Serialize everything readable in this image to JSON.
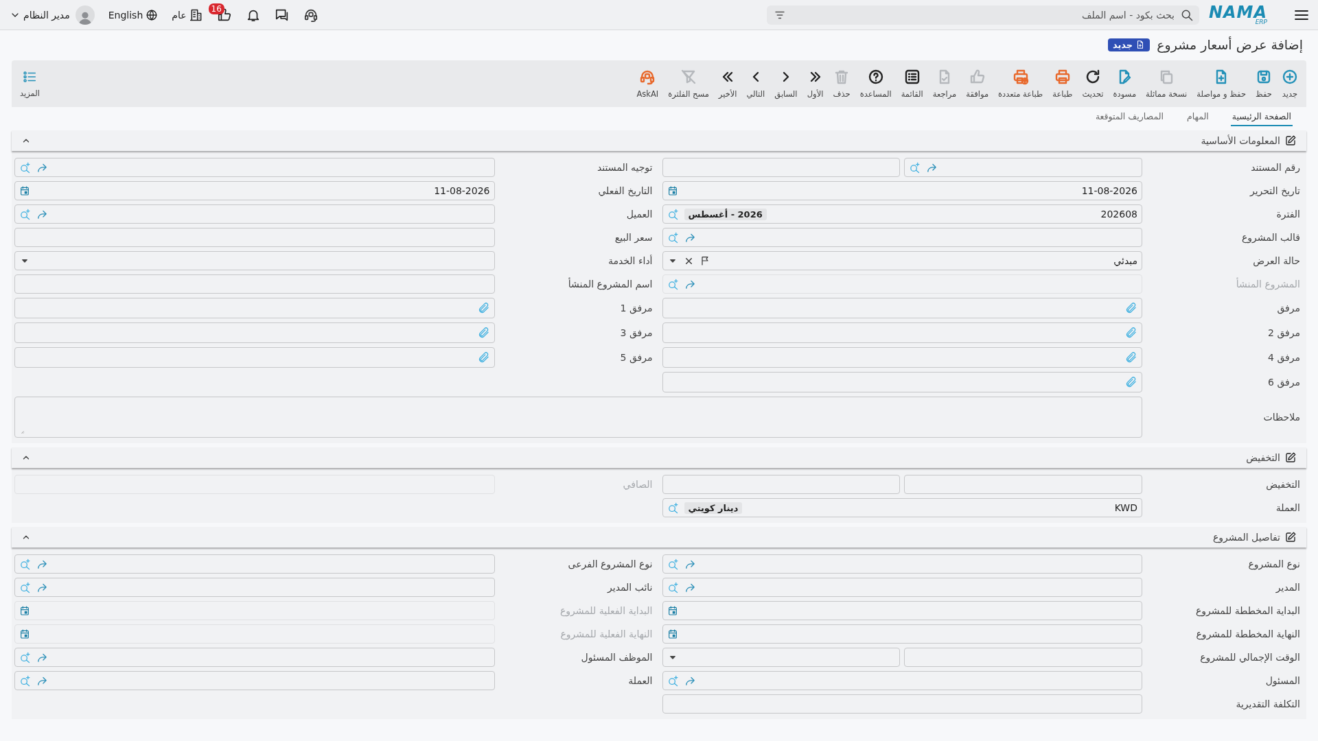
{
  "topbar": {
    "logo": {
      "name": "NAMA",
      "sub": "ERP"
    },
    "search": {
      "placeholder": "بحث بكود - اسم الملف"
    },
    "notifications_badge": "16",
    "company": "عام",
    "language": "English",
    "user": "مدير النظام"
  },
  "page_title": "إضافة عرض أسعار مشروع",
  "status_badge": "جديد",
  "toolbar": [
    {
      "label": "جديد",
      "kind": "add",
      "color": "#2391b8"
    },
    {
      "label": "حفظ",
      "kind": "save",
      "color": "#2391b8"
    },
    {
      "label": "حفظ و مواصلة",
      "kind": "savenext",
      "color": "#2391b8"
    },
    {
      "label": "نسخة مماثلة",
      "kind": "copy",
      "color": "#b5b8bc"
    },
    {
      "label": "مسودة",
      "kind": "draft",
      "color": "#2391b8"
    },
    {
      "label": "تحديث",
      "kind": "refresh",
      "color": "#222222"
    },
    {
      "label": "طباعة",
      "kind": "print",
      "color": "#e8692c"
    },
    {
      "label": "طباعة متعددة",
      "kind": "printmany",
      "color": "#e8692c"
    },
    {
      "label": "موافقة",
      "kind": "approve",
      "color": "#b5b8bc"
    },
    {
      "label": "مراجعة",
      "kind": "review",
      "color": "#b5b8bc"
    },
    {
      "label": "القائمة",
      "kind": "list",
      "color": "#222222"
    },
    {
      "label": "المساعدة",
      "kind": "help",
      "color": "#222222"
    },
    {
      "label": "حذف",
      "kind": "delete",
      "color": "#b5b8bc"
    },
    {
      "label": "الأول",
      "kind": "first",
      "color": "#222222"
    },
    {
      "label": "السابق",
      "kind": "previous",
      "color": "#222222"
    },
    {
      "label": "التالي",
      "kind": "next",
      "color": "#222222"
    },
    {
      "label": "الأخير",
      "kind": "last",
      "color": "#222222"
    },
    {
      "label": "مسح الفلترة",
      "kind": "unfilter",
      "color": "#b5b8bc"
    },
    {
      "label": "AskAI",
      "kind": "askai",
      "color": "#e8692c"
    }
  ],
  "more": {
    "label": "المزيد"
  },
  "tabs": [
    {
      "label": "الصفحة الرئيسية",
      "selected": true
    },
    {
      "label": "المهام",
      "selected": false
    },
    {
      "label": "المصاريف المتوقعة",
      "selected": false
    }
  ],
  "sections": [
    {
      "title": "المعلومات الأساسية",
      "expanded": true,
      "columns": [
        [
          {
            "label": "رقم المستند",
            "disabled": false,
            "parts": [
              {
                "kind": "lookup"
              },
              {
                "kind": "text"
              }
            ]
          },
          {
            "label": "تاريخ التحرير",
            "disabled": false,
            "parts": [
              {
                "kind": "date",
                "value": "11-08-2026"
              }
            ]
          },
          {
            "label": "الفترة",
            "disabled": false,
            "parts": [
              {
                "kind": "search",
                "value": "202608",
                "chip": "2026 - أغسطس"
              }
            ]
          },
          {
            "label": "قالب المشروع",
            "disabled": false,
            "parts": [
              {
                "kind": "lookup"
              }
            ]
          },
          {
            "label": "حالة العرض",
            "disabled": false,
            "parts": [
              {
                "kind": "status",
                "value": "مبدئي"
              }
            ]
          },
          {
            "label": "المشروع المنشأ",
            "disabled": true,
            "parts": [
              {
                "kind": "lookup"
              }
            ]
          },
          {
            "label": "مرفق",
            "disabled": false,
            "parts": [
              {
                "kind": "attach"
              }
            ]
          },
          {
            "label": "مرفق 2",
            "disabled": false,
            "parts": [
              {
                "kind": "attach"
              }
            ]
          },
          {
            "label": "مرفق 4",
            "disabled": false,
            "parts": [
              {
                "kind": "attach"
              }
            ]
          },
          {
            "label": "مرفق 6",
            "disabled": false,
            "parts": [
              {
                "kind": "attach"
              }
            ]
          }
        ],
        [
          {
            "label": "توجيه المستند",
            "disabled": false,
            "parts": [
              {
                "kind": "lookup"
              }
            ]
          },
          {
            "label": "التاريخ الفعلي",
            "disabled": false,
            "parts": [
              {
                "kind": "date",
                "value": "11-08-2026"
              }
            ]
          },
          {
            "label": "العميل",
            "disabled": false,
            "parts": [
              {
                "kind": "lookup"
              }
            ]
          },
          {
            "label": "سعر البيع",
            "disabled": false,
            "parts": [
              {
                "kind": "text"
              }
            ]
          },
          {
            "label": "أداء الخدمة",
            "disabled": false,
            "parts": [
              {
                "kind": "select"
              }
            ]
          },
          {
            "label": "اسم المشروع المنشأ",
            "disabled": false,
            "parts": [
              {
                "kind": "text"
              }
            ]
          },
          {
            "label": "مرفق 1",
            "disabled": false,
            "parts": [
              {
                "kind": "attach"
              }
            ]
          },
          {
            "label": "مرفق 3",
            "disabled": false,
            "parts": [
              {
                "kind": "attach"
              }
            ]
          },
          {
            "label": "مرفق 5",
            "disabled": false,
            "parts": [
              {
                "kind": "attach"
              }
            ]
          }
        ]
      ],
      "wide": [
        {
          "label": "ملاحظات",
          "disabled": false,
          "parts": [
            {
              "kind": "notes"
            }
          ]
        }
      ]
    },
    {
      "title": "التخفيض",
      "expanded": true,
      "columns": [
        [
          {
            "label": "التخفيض",
            "disabled": false,
            "parts": [
              {
                "kind": "text"
              },
              {
                "kind": "text"
              }
            ]
          },
          {
            "label": "العملة",
            "disabled": false,
            "parts": [
              {
                "kind": "search",
                "value": "KWD",
                "chip": "دينار كويتي"
              }
            ]
          }
        ],
        [
          {
            "label": "الصافي",
            "disabled": true,
            "parts": [
              {
                "kind": "text"
              }
            ]
          }
        ]
      ]
    },
    {
      "title": "تفاصيل المشروع",
      "expanded": true,
      "columns": [
        [
          {
            "label": "نوع المشروع",
            "disabled": false,
            "parts": [
              {
                "kind": "lookup"
              }
            ]
          },
          {
            "label": "المدير",
            "disabled": false,
            "parts": [
              {
                "kind": "lookup"
              }
            ]
          },
          {
            "label": "البداية المخططة للمشروع",
            "disabled": false,
            "parts": [
              {
                "kind": "date"
              }
            ]
          },
          {
            "label": "النهاية المخططة للمشروع",
            "disabled": false,
            "parts": [
              {
                "kind": "date"
              }
            ]
          },
          {
            "label": "الوقت الإجمالي للمشروع",
            "disabled": false,
            "parts": [
              {
                "kind": "text"
              },
              {
                "kind": "select"
              }
            ]
          },
          {
            "label": "المسئول",
            "disabled": false,
            "parts": [
              {
                "kind": "lookup"
              }
            ]
          },
          {
            "label": "التكلفة التقديرية",
            "disabled": false,
            "parts": [
              {
                "kind": "text"
              }
            ]
          }
        ],
        [
          {
            "label": "نوع المشروع الفرعى",
            "disabled": false,
            "parts": [
              {
                "kind": "lookup"
              }
            ]
          },
          {
            "label": "نائب المدير",
            "disabled": false,
            "parts": [
              {
                "kind": "lookup"
              }
            ]
          },
          {
            "label": "البداية الفعلية للمشروع",
            "disabled": true,
            "parts": [
              {
                "kind": "date"
              }
            ]
          },
          {
            "label": "النهاية الفعلية للمشروع",
            "disabled": true,
            "parts": [
              {
                "kind": "date"
              }
            ]
          },
          {
            "label": "الموظف المسئول",
            "disabled": false,
            "parts": [
              {
                "kind": "lookup"
              }
            ]
          },
          {
            "label": "العملة",
            "disabled": false,
            "parts": [
              {
                "kind": "lookup"
              }
            ]
          }
        ]
      ]
    }
  ]
}
